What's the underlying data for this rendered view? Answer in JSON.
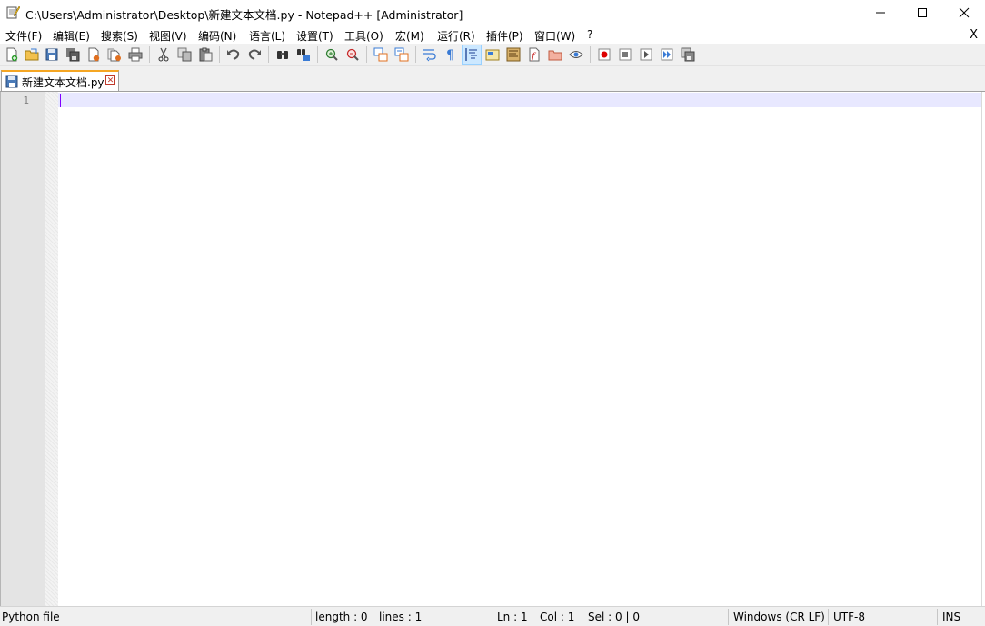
{
  "window": {
    "title": "C:\\Users\\Administrator\\Desktop\\新建文本文档.py - Notepad++ [Administrator]",
    "icon": "notepad-plus-plus-icon",
    "minimize_icon": "minimize-icon",
    "maximize_icon": "maximize-icon",
    "close_icon": "close-icon"
  },
  "menu": {
    "items": [
      "文件(F)",
      "编辑(E)",
      "搜索(S)",
      "视图(V)",
      "编码(N)",
      "语言(L)",
      "设置(T)",
      "工具(O)",
      "宏(M)",
      "运行(R)",
      "插件(P)",
      "窗口(W)",
      "?"
    ],
    "close_label": "X"
  },
  "toolbar": {
    "buttons": [
      {
        "name": "new-file",
        "icon": "new-file-icon"
      },
      {
        "name": "open-file",
        "icon": "open-folder-icon"
      },
      {
        "name": "save",
        "icon": "save-icon"
      },
      {
        "name": "save-all",
        "icon": "save-all-icon"
      },
      {
        "name": "close",
        "icon": "close-file-icon"
      },
      {
        "name": "close-all",
        "icon": "close-all-icon"
      },
      {
        "name": "print",
        "icon": "print-icon"
      },
      {
        "name": "cut",
        "icon": "cut-icon"
      },
      {
        "name": "copy",
        "icon": "copy-icon"
      },
      {
        "name": "paste",
        "icon": "paste-icon"
      },
      {
        "name": "undo",
        "icon": "undo-icon"
      },
      {
        "name": "redo",
        "icon": "redo-icon"
      },
      {
        "name": "find",
        "icon": "find-icon"
      },
      {
        "name": "replace",
        "icon": "replace-icon"
      },
      {
        "name": "zoom-in",
        "icon": "zoom-in-icon"
      },
      {
        "name": "zoom-out",
        "icon": "zoom-out-icon"
      },
      {
        "name": "sync-vertical",
        "icon": "sync-vertical-icon"
      },
      {
        "name": "sync-horizontal",
        "icon": "sync-horizontal-icon"
      },
      {
        "name": "word-wrap",
        "icon": "word-wrap-icon"
      },
      {
        "name": "show-all-chars",
        "icon": "pilcrow-icon"
      },
      {
        "name": "indent-guide",
        "icon": "indent-guide-icon"
      },
      {
        "name": "udl",
        "icon": "user-language-icon"
      },
      {
        "name": "doc-map",
        "icon": "document-map-icon"
      },
      {
        "name": "function-list",
        "icon": "function-list-icon"
      },
      {
        "name": "folder-as-workspace",
        "icon": "folder-workspace-icon"
      },
      {
        "name": "monitoring",
        "icon": "eye-icon"
      },
      {
        "name": "record-macro",
        "icon": "record-icon"
      },
      {
        "name": "stop-macro",
        "icon": "stop-icon"
      },
      {
        "name": "play-macro",
        "icon": "play-icon"
      },
      {
        "name": "run-macro-multiple",
        "icon": "fast-forward-icon"
      },
      {
        "name": "save-macro",
        "icon": "save-macro-icon"
      }
    ],
    "active": "indent-guide"
  },
  "tabs": [
    {
      "label": "新建文本文档.py",
      "icon": "saved-file-icon",
      "close_icon": "tab-close-icon",
      "active": true
    }
  ],
  "editor": {
    "line_numbers": [
      "1"
    ],
    "current_line_color": "#e8e8ff",
    "caret_color": "#8000ff"
  },
  "statusbar": {
    "file_type": "Python file",
    "length": "length : 0",
    "lines": "lines : 1",
    "ln": "Ln : 1",
    "col": "Col : 1",
    "sel": "Sel : 0 | 0",
    "eol": "Windows (CR LF)",
    "encoding": "UTF-8",
    "mode": "INS"
  }
}
